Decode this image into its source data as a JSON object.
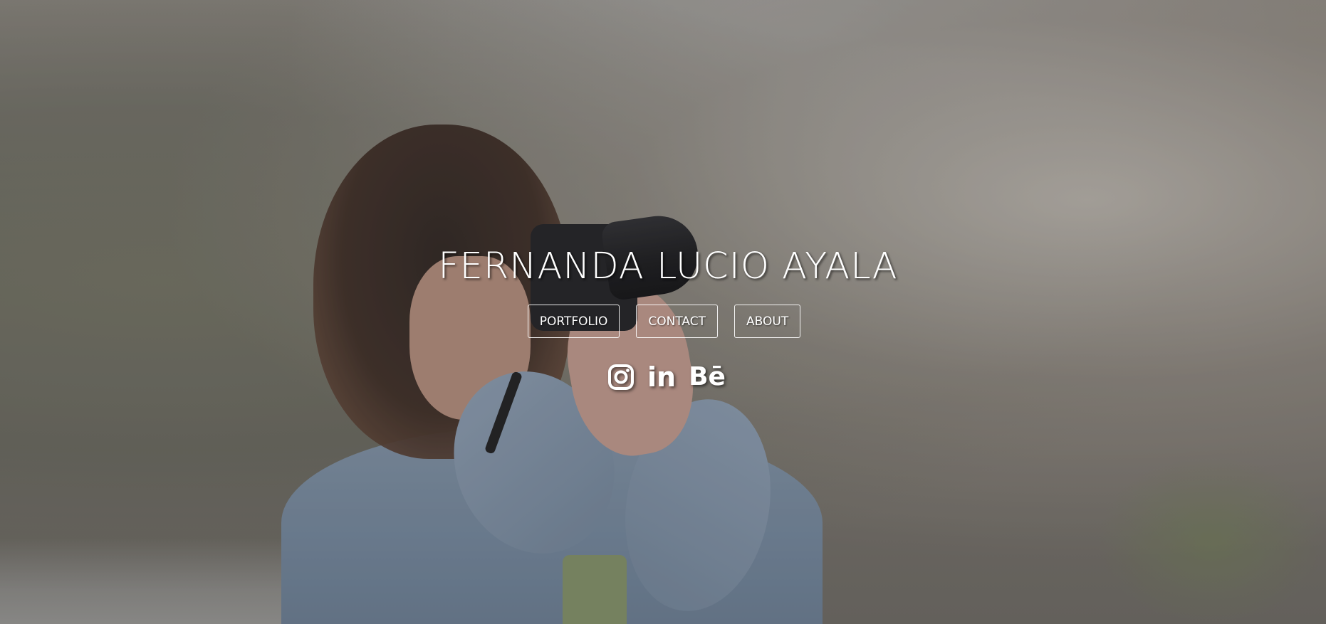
{
  "header": {
    "title": "FERNANDA LUCIO AYALA"
  },
  "nav": {
    "items": [
      {
        "label": "PORTFOLIO"
      },
      {
        "label": "CONTACT"
      },
      {
        "label": "ABOUT"
      }
    ]
  },
  "social": {
    "items": [
      {
        "icon": "instagram-icon"
      },
      {
        "icon": "linkedin-icon",
        "glyph": "in"
      },
      {
        "icon": "behance-icon",
        "glyph": "Bē"
      }
    ]
  },
  "colors": {
    "text": "#ffffff",
    "button_border": "#ffffff",
    "overlay": "#464646"
  }
}
